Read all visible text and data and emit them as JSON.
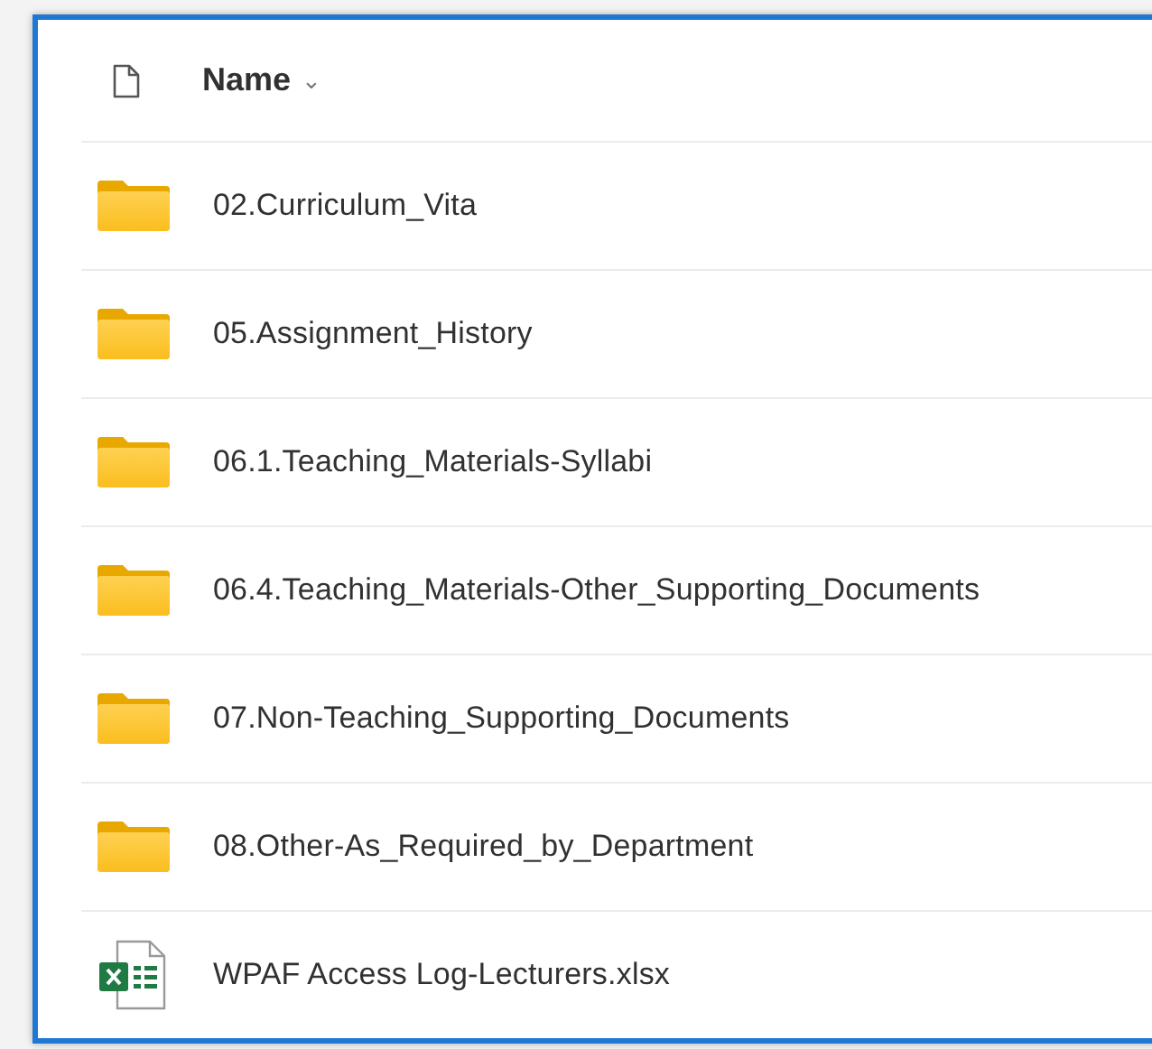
{
  "header": {
    "column": "Name",
    "sort_glyph": "⌄"
  },
  "files": [
    {
      "kind": "folder",
      "name": "02.Curriculum_Vita"
    },
    {
      "kind": "folder",
      "name": "05.Assignment_History"
    },
    {
      "kind": "folder",
      "name": "06.1.Teaching_Materials-Syllabi"
    },
    {
      "kind": "folder",
      "name": "06.4.Teaching_Materials-Other_Supporting_Documents"
    },
    {
      "kind": "folder",
      "name": "07.Non-Teaching_Supporting_Documents"
    },
    {
      "kind": "folder",
      "name": "08.Other-As_Required_by_Department"
    },
    {
      "kind": "excel",
      "name": "WPAF Access Log-Lecturers.xlsx"
    }
  ]
}
